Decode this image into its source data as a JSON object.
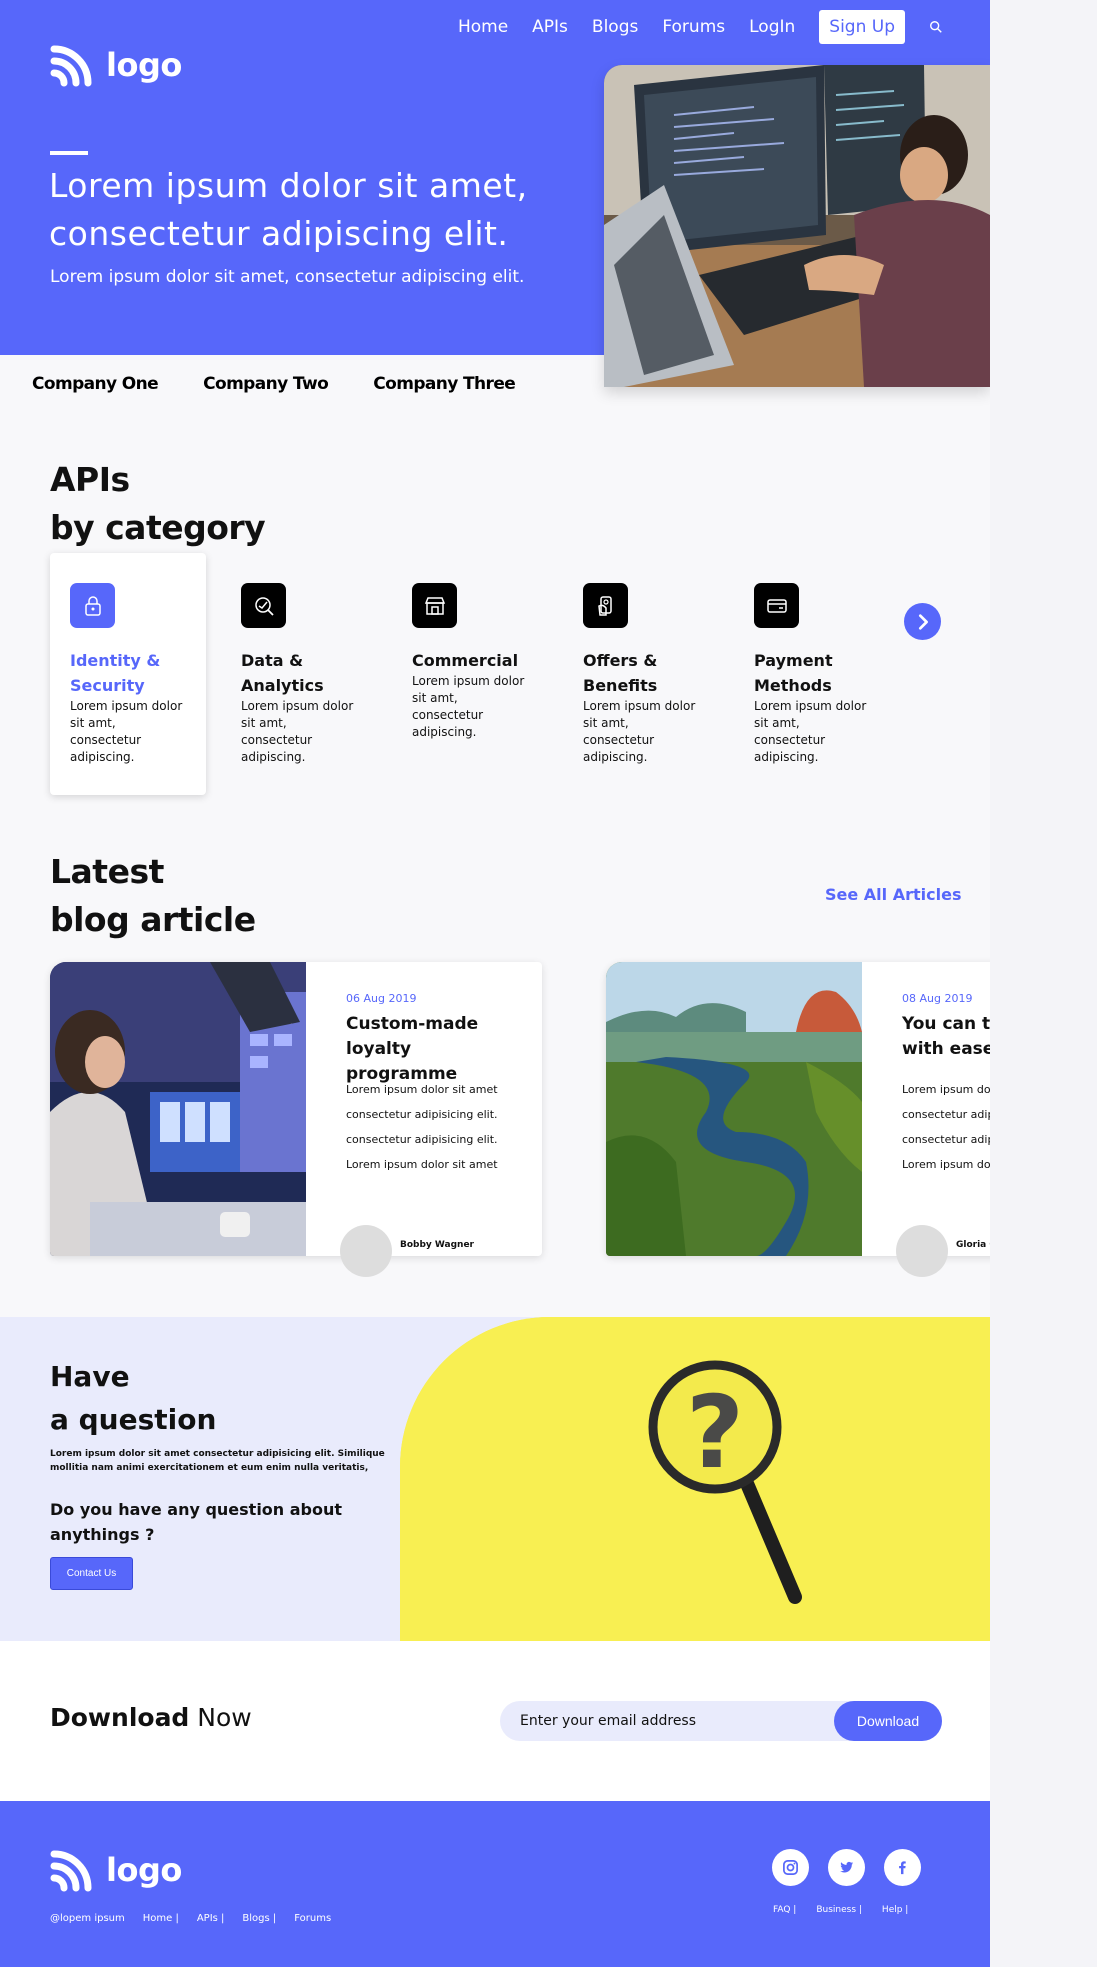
{
  "nav": {
    "logo_text": "logo",
    "items": [
      "Home",
      "APIs",
      "Blogs",
      "Forums",
      "LogIn"
    ],
    "signup": "Sign Up"
  },
  "hero": {
    "title": "Lorem ipsum dolor sit amet, consectetur adipiscing elit.",
    "subtitle": "Lorem ipsum dolor sit amet, consectetur adipiscing elit."
  },
  "companies": [
    "Company One",
    "Company Two",
    "Company Three"
  ],
  "apis": {
    "heading_line1": "APIs",
    "heading_line2": "by category",
    "categories": [
      {
        "title": "Identity & Security",
        "desc": "Lorem ipsum dolor sit amt, consectetur adipiscing.",
        "icon": "lock-icon"
      },
      {
        "title": "Data & Analytics",
        "desc": "Lorem ipsum dolor sit amt, consectetur adipiscing.",
        "icon": "analytics-icon"
      },
      {
        "title": "Commercial",
        "desc": "Lorem ipsum dolor sit amt, consectetur adipiscing.",
        "icon": "store-icon"
      },
      {
        "title": "Offers & Benefits",
        "desc": "Lorem ipsum dolor sit amt, consectetur adipiscing.",
        "icon": "offer-icon"
      },
      {
        "title": "Payment Methods",
        "desc": "Lorem ipsum dolor sit amt, consectetur adipiscing.",
        "icon": "card-icon"
      }
    ]
  },
  "blog": {
    "heading_line1": "Latest",
    "heading_line2": "blog article",
    "see_all": "See All Articles",
    "articles": [
      {
        "date": "06 Aug 2019",
        "title": "Custom-made loyalty programme",
        "lines": [
          "Lorem ipsum dolor sit amet",
          "consectetur adipisicing elit.",
          "consectetur adipisicing elit.",
          "Lorem ipsum dolor sit amet"
        ],
        "author": "Bobby Wagner"
      },
      {
        "date": "08 Aug 2019",
        "title": "You can travel with ease",
        "lines": [
          "Lorem ipsum dolor sit amet",
          "consectetur adipisicing elit.",
          "consectetur adipisicing elit.",
          "Lorem ipsum dolor sit amet"
        ],
        "author": "Gloria Graham"
      }
    ]
  },
  "question": {
    "heading_line1": "Have",
    "heading_line2": "a question",
    "lorem": "Lorem ipsum dolor sit amet consectetur adipisicing elit. Similique mollitia nam animi exercitationem et eum enim nulla veritatis,",
    "ask": "Do you have any question about anythings ?",
    "contact": "Contact Us"
  },
  "download": {
    "title_bold": "Download",
    "title_rest": " Now",
    "placeholder": "Enter your email address",
    "button": "Download"
  },
  "footer": {
    "logo_text": "logo",
    "links": [
      "@lopem ipsum",
      "Home |",
      "APIs |",
      "Blogs |",
      "Forums"
    ],
    "right_links": [
      "FAQ |",
      "Business |",
      "Help |"
    ]
  },
  "colors": {
    "accent": "#5767fa",
    "yellow": "#f8ef52",
    "light": "#e9ebfc"
  }
}
